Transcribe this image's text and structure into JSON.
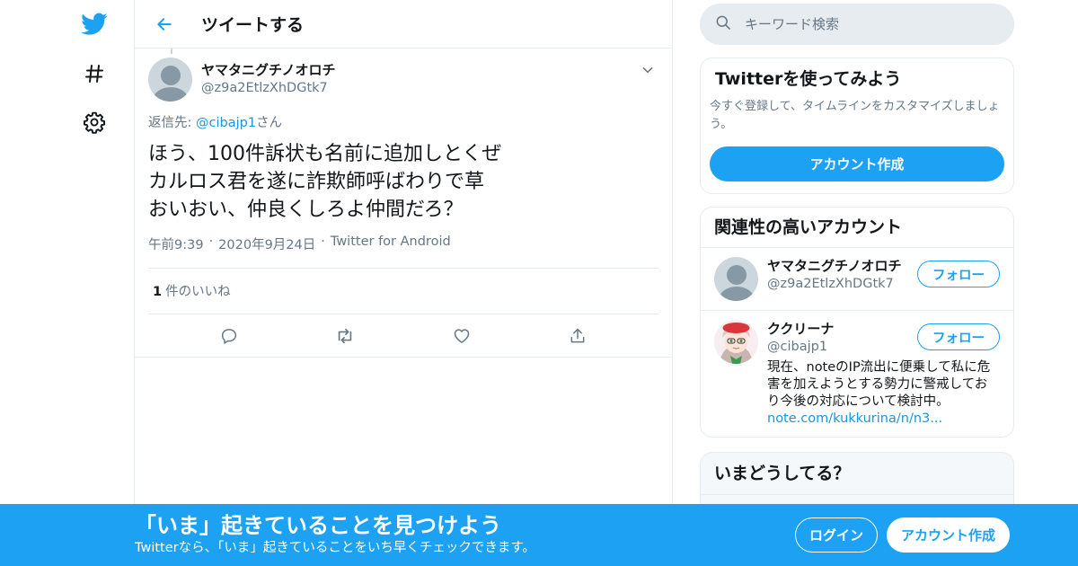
{
  "nav": {
    "icons": [
      "twitter-bird-icon",
      "hashtag-icon",
      "settings-gear-icon"
    ]
  },
  "header": {
    "title": "ツイートする"
  },
  "tweet": {
    "display_name": "ヤマタニグチノオロチ",
    "handle": "@z9a2EtlzXhDGtk7",
    "reply_prefix": "返信先: ",
    "reply_to": "@cibajp1",
    "reply_suffix": "さん",
    "text": "ほう、100件訴状も名前に追加しとくぜ\nカルロス君を遂に詐欺師呼ばわりで草\nおいおい、仲良くしろよ仲間だろ？",
    "time": "午前9:39",
    "date": "2020年9月24日",
    "source": "Twitter for Android",
    "likes_count": "1",
    "likes_label": "件のいいね"
  },
  "search": {
    "placeholder": "キーワード検索"
  },
  "signup_card": {
    "title": "Twitterを使ってみよう",
    "description": "今すぐ登録して、タイムラインをカスタマイズしましょう。",
    "button": "アカウント作成"
  },
  "related": {
    "title": "関連性の高いアカウント",
    "accounts": [
      {
        "name": "ヤマタニグチノオロチ",
        "handle": "@z9a2EtlzXhDGtk7",
        "follow": "フォロー",
        "bio": "",
        "bio_link": ""
      },
      {
        "name": "ククリーナ",
        "handle": "@cibajp1",
        "follow": "フォロー",
        "bio": "現在、noteのIP流出に便乗して私に危害を加えようとする勢力に警戒しており今後の対応について検討中。",
        "bio_link": "note.com/kukkurina/n/n3..."
      }
    ]
  },
  "trends": {
    "title": "いまどうしてる？"
  },
  "bottom_bar": {
    "title": "「いま」起きていることを見つけよう",
    "subtitle": "Twitterなら、「いま」起きていることをいち早くチェックできます。",
    "login": "ログイン",
    "signup": "アカウント作成"
  },
  "colors": {
    "accent": "#1da1f2",
    "link": "#1b95e0",
    "muted": "#657786",
    "border": "#e6ecf0"
  }
}
